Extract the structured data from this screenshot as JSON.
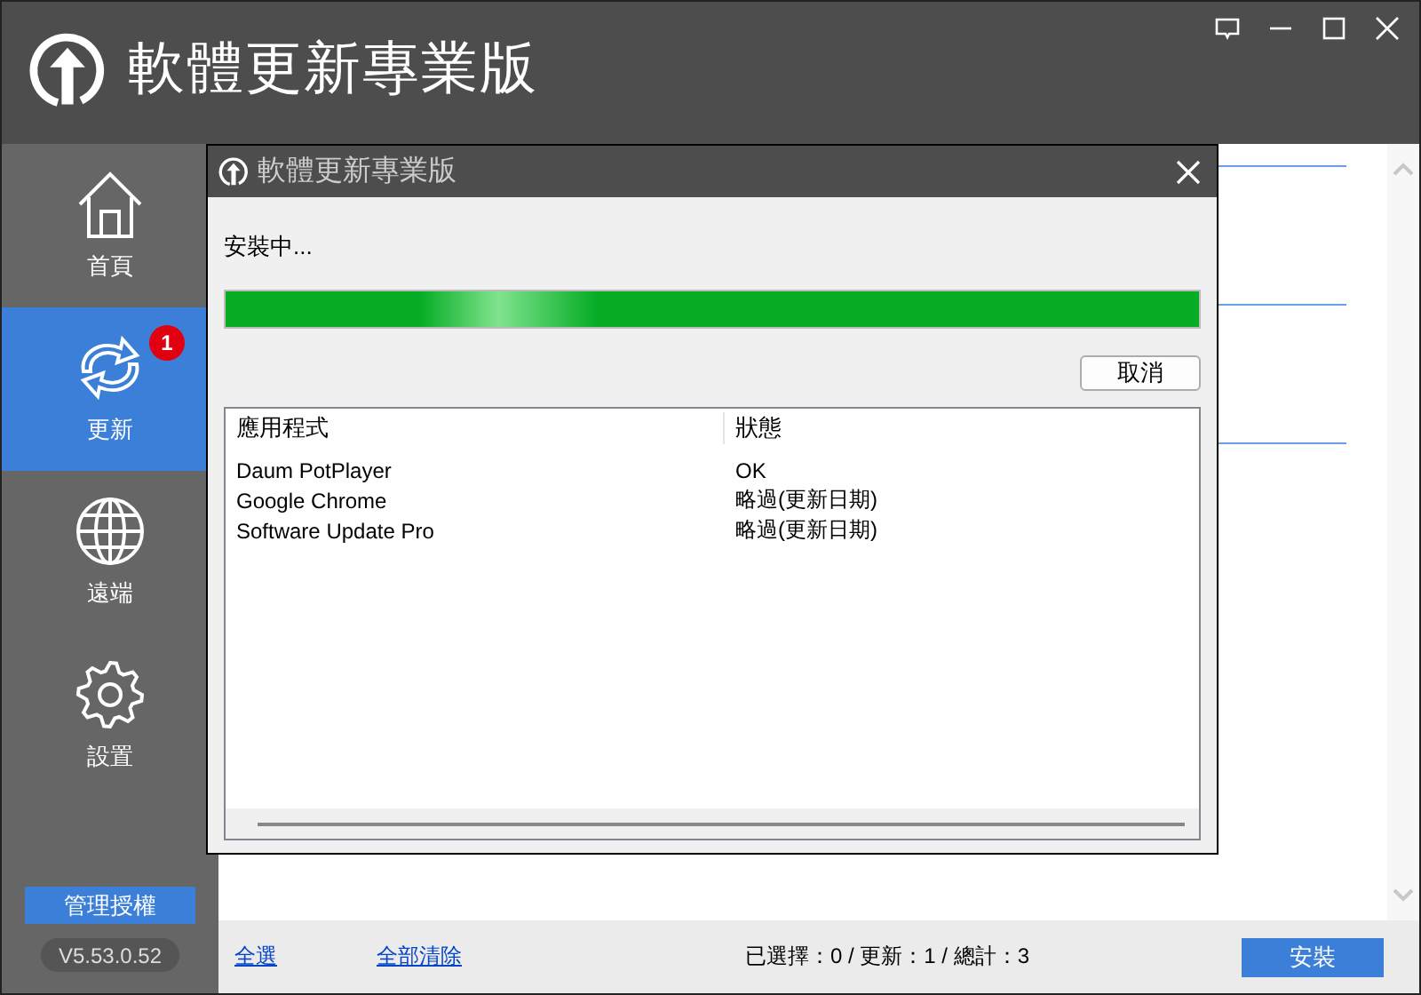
{
  "app": {
    "title": "軟體更新專業版"
  },
  "sidebar": {
    "items": [
      {
        "label": "首頁",
        "kind": "home",
        "selected": false
      },
      {
        "label": "更新",
        "kind": "refresh",
        "selected": true,
        "badge": "1"
      },
      {
        "label": "遠端",
        "kind": "globe",
        "selected": false
      },
      {
        "label": "設置",
        "kind": "gear",
        "selected": false
      }
    ],
    "license_button": "管理授權",
    "version": "V5.53.0.52"
  },
  "dialog": {
    "title": "軟體更新專業版",
    "status": "安裝中...",
    "progress": {
      "level": 1
    },
    "cancel_button": "取消",
    "table": {
      "columns": [
        "應用程式",
        "狀態"
      ],
      "rows": [
        {
          "cells": [
            "Daum PotPlayer",
            "OK"
          ]
        },
        {
          "cells": [
            "Google Chrome",
            "略過(更新日期)"
          ]
        },
        {
          "cells": [
            "Software Update Pro",
            "略過(更新日期)"
          ]
        }
      ]
    }
  },
  "footer": {
    "select_all": "全選",
    "clear_all": "全部清除",
    "summary": "已選擇：0 / 更新：1 / 總計：3",
    "install_button": "安裝"
  }
}
